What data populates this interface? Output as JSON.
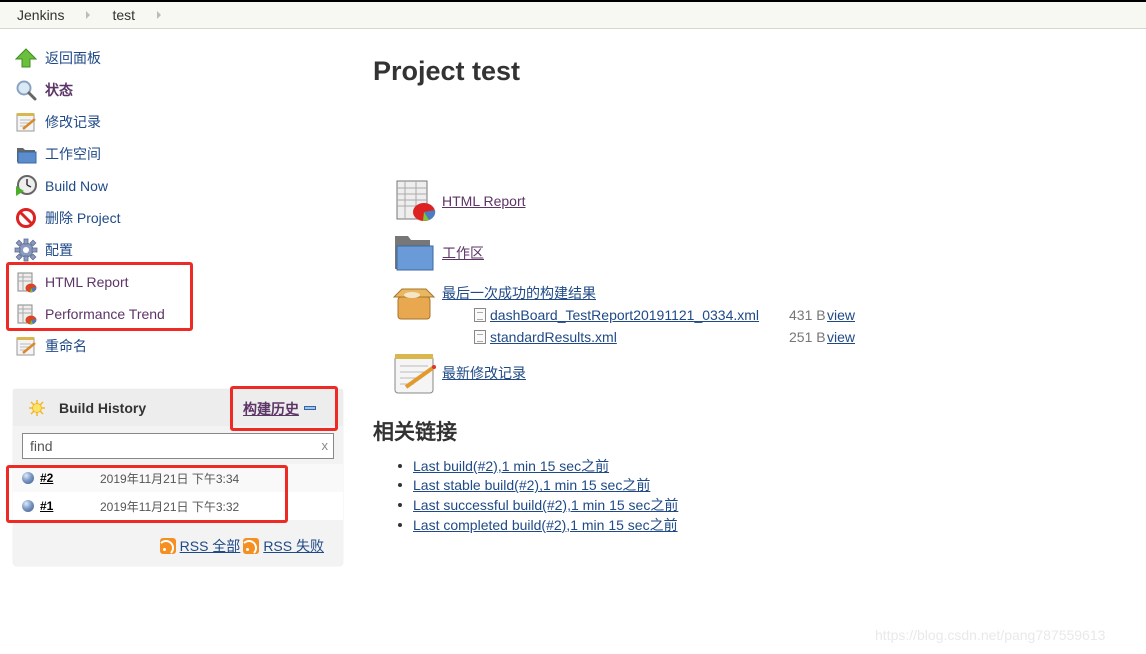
{
  "breadcrumbs": [
    {
      "label": "Jenkins"
    },
    {
      "label": "test"
    }
  ],
  "sidebar": {
    "tasks": [
      {
        "label": "返回面板",
        "icon": "up-arrow-icon"
      },
      {
        "label": "状态",
        "icon": "search-icon"
      },
      {
        "label": "修改记录",
        "icon": "notepad-icon"
      },
      {
        "label": "工作空间",
        "icon": "folder-icon"
      },
      {
        "label": "Build Now",
        "icon": "clock-icon"
      },
      {
        "label": "删除 Project",
        "icon": "no-entry-icon"
      },
      {
        "label": "配置",
        "icon": "gear-icon"
      },
      {
        "label": "HTML Report",
        "icon": "report-chart-icon"
      },
      {
        "label": "Performance Trend",
        "icon": "report-chart-icon"
      },
      {
        "label": "重命名",
        "icon": "notepad-icon"
      }
    ]
  },
  "build_history": {
    "title": "Build History",
    "trend_link": "构建历史",
    "search_placeholder": "find",
    "search_clear": "x",
    "builds": [
      {
        "number": "#2",
        "date": "2019年11月21日 下午3:34"
      },
      {
        "number": "#1",
        "date": "2019年11月21日 下午3:32"
      }
    ],
    "rss_all": "RSS 全部",
    "rss_failed": "RSS 失败"
  },
  "main": {
    "title": "Project test",
    "links": {
      "html_report": "HTML Report",
      "workspace": "工作区",
      "last_successful": "最后一次成功的构建结果",
      "recent_changes": "最新修改记录"
    },
    "artifacts": [
      {
        "name": "dashBoard_TestReport20191121_0334.xml",
        "size": "431 B",
        "view": "view"
      },
      {
        "name": "standardResults.xml",
        "size": "251 B",
        "view": "view"
      }
    ],
    "related_heading": "相关链接",
    "permalinks": [
      "Last build(#2),1 min 15 sec之前",
      "Last stable build(#2),1 min 15 sec之前",
      "Last successful build(#2),1 min 15 sec之前",
      "Last completed build(#2),1 min 15 sec之前"
    ]
  },
  "watermark": "https://blog.csdn.net/pang787559613"
}
